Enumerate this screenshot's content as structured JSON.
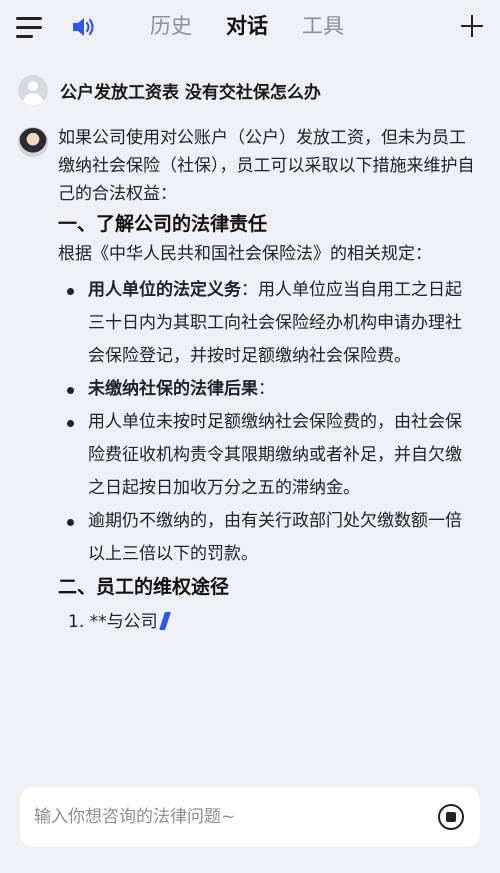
{
  "header": {
    "tabs": [
      {
        "label": "历史",
        "active": false
      },
      {
        "label": "对话",
        "active": true
      },
      {
        "label": "工具",
        "active": false
      }
    ],
    "icons": {
      "menu": "menu-icon",
      "speaker": "speaker-icon",
      "plus": "plus-icon"
    }
  },
  "user_question": "公户发放工资表 没有交社保怎么办",
  "answer": {
    "intro": "如果公司使用对公账户（公户）发放工资，但未为员工缴纳社会保险（社保），员工可以采取以下措施来维护自己的合法权益：",
    "section1_title": "一、了解公司的法律责任",
    "section1_intro": "根据《中华人民共和国社会保险法》的相关规定：",
    "bullets": [
      {
        "bold": "用人单位的法定义务",
        "text": "：用人单位应当自用工之日起三十日内为其职工向社会保险经办机构申请办理社会保险登记，并按时足额缴纳社会保险费。"
      },
      {
        "bold": "未缴纳社保的法律后果",
        "text": "："
      },
      {
        "bold": "",
        "text": "用人单位未按时足额缴纳社会保险费的，由社会保险费征收机构责令其限期缴纳或者补足，并自欠缴之日起按日加收万分之五的滞纳金。"
      },
      {
        "bold": "",
        "text": "逾期仍不缴纳的，由有关行政部门处欠缴数额一倍以上三倍以下的罚款。"
      }
    ],
    "section2_title": "二、员工的维权途径",
    "numbered_item": "1. **与公司"
  },
  "input": {
    "placeholder": "输入你想咨询的法律问题~",
    "value": ""
  },
  "colors": {
    "accent": "#2b5be8",
    "background": "#eef0f6"
  }
}
